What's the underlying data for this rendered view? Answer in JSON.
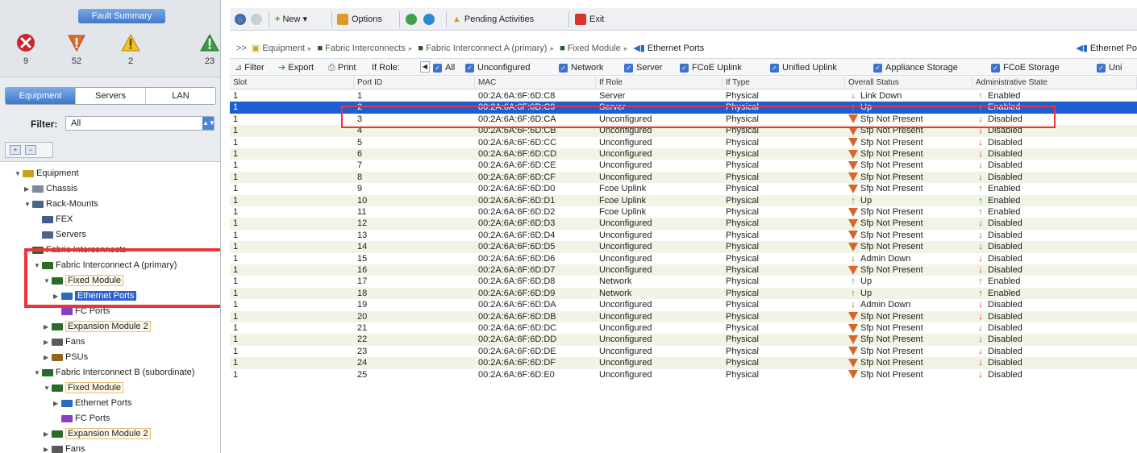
{
  "fault_summary": {
    "title": "Fault Summary",
    "counts": [
      {
        "icon": "critical-x-icon",
        "value": "9"
      },
      {
        "icon": "major-triangle-down-icon",
        "value": "52"
      },
      {
        "icon": "minor-warning-icon",
        "value": "2"
      },
      {
        "icon": "warning-icon",
        "value": "23"
      }
    ]
  },
  "left_tabs": [
    "Equipment",
    "Servers",
    "LAN"
  ],
  "filter": {
    "label": "Filter:",
    "value": "All"
  },
  "tree": [
    {
      "label": "Equipment",
      "indent": 0,
      "twisty": "▼",
      "icon": "equipment-icon"
    },
    {
      "label": "Chassis",
      "indent": 1,
      "twisty": "▶",
      "icon": "chassis-icon"
    },
    {
      "label": "Rack-Mounts",
      "indent": 1,
      "twisty": "▼",
      "icon": "rack-icon"
    },
    {
      "label": "FEX",
      "indent": 2,
      "twisty": "",
      "icon": "fex-icon"
    },
    {
      "label": "Servers",
      "indent": 2,
      "twisty": "",
      "icon": "servers-icon"
    },
    {
      "label": "Fabric Interconnects",
      "indent": 1,
      "twisty": "▼",
      "icon": "fabric-icon"
    },
    {
      "label": "Fabric Interconnect A (primary)",
      "indent": 2,
      "twisty": "▼",
      "icon": "fabric-icon"
    },
    {
      "label": "Fixed Module",
      "indent": 3,
      "twisty": "▼",
      "icon": "module-icon"
    },
    {
      "label": "Ethernet Ports",
      "indent": 4,
      "twisty": "▶",
      "icon": "ethernet-port-icon"
    },
    {
      "label": "FC Ports",
      "indent": 4,
      "twisty": "",
      "icon": "fc-port-icon"
    },
    {
      "label": "Expansion Module 2",
      "indent": 3,
      "twisty": "▶",
      "icon": "module-icon"
    },
    {
      "label": "Fans",
      "indent": 3,
      "twisty": "▶",
      "icon": "fan-icon"
    },
    {
      "label": "PSUs",
      "indent": 3,
      "twisty": "▶",
      "icon": "psu-icon"
    },
    {
      "label": "Fabric Interconnect B (subordinate)",
      "indent": 2,
      "twisty": "▼",
      "icon": "fabric-icon"
    },
    {
      "label": "Fixed Module",
      "indent": 3,
      "twisty": "▼",
      "icon": "module-icon"
    },
    {
      "label": "Ethernet Ports",
      "indent": 4,
      "twisty": "▶",
      "icon": "ethernet-port-icon"
    },
    {
      "label": "FC Ports",
      "indent": 4,
      "twisty": "",
      "icon": "fc-port-icon"
    },
    {
      "label": "Expansion Module 2",
      "indent": 3,
      "twisty": "▶",
      "icon": "module-icon"
    },
    {
      "label": "Fans",
      "indent": 3,
      "twisty": "▶",
      "icon": "fan-icon"
    }
  ],
  "toolbar": {
    "new_label": "New",
    "options_label": "Options",
    "pending_label": "Pending Activities",
    "exit_label": "Exit"
  },
  "breadcrumb": {
    "prefix": ">>",
    "items": [
      "Equipment",
      "Fabric Interconnects",
      "Fabric Interconnect A (primary)",
      "Fixed Module",
      "Ethernet Ports"
    ],
    "right_label": "Ethernet Po"
  },
  "filterbar": {
    "filter_label": "Filter",
    "export_label": "Export",
    "print_label": "Print",
    "role_label": "If Role:",
    "checks": [
      "All",
      "Unconfigured",
      "Network",
      "Server",
      "FCoE Uplink",
      "Unified Uplink",
      "Appliance Storage",
      "FCoE Storage",
      "Uni"
    ]
  },
  "table": {
    "columns": [
      "Slot",
      "Port ID",
      "MAC",
      "If Role",
      "If Type",
      "Overall Status",
      "Administrative State"
    ],
    "rows": [
      {
        "slot": "1",
        "port": "1",
        "mac": "00:2A:6A:6F:6D:C8",
        "role": "Server",
        "type": "Physical",
        "status": "Link Down",
        "status_kind": "down",
        "admin": "Enabled",
        "admin_kind": "up"
      },
      {
        "slot": "1",
        "port": "2",
        "mac": "00:2A:6A:6F:6D:C9",
        "role": "Server",
        "type": "Physical",
        "status": "Up",
        "status_kind": "up",
        "admin": "Enabled",
        "admin_kind": "up"
      },
      {
        "slot": "1",
        "port": "3",
        "mac": "00:2A:6A:6F:6D:CA",
        "role": "Unconfigured",
        "type": "Physical",
        "status": "Sfp Not Present",
        "status_kind": "warn",
        "admin": "Disabled",
        "admin_kind": "down"
      },
      {
        "slot": "1",
        "port": "4",
        "mac": "00:2A:6A:6F:6D:CB",
        "role": "Unconfigured",
        "type": "Physical",
        "status": "Sfp Not Present",
        "status_kind": "warn",
        "admin": "Disabled",
        "admin_kind": "down"
      },
      {
        "slot": "1",
        "port": "5",
        "mac": "00:2A:6A:6F:6D:CC",
        "role": "Unconfigured",
        "type": "Physical",
        "status": "Sfp Not Present",
        "status_kind": "warn",
        "admin": "Disabled",
        "admin_kind": "down"
      },
      {
        "slot": "1",
        "port": "6",
        "mac": "00:2A:6A:6F:6D:CD",
        "role": "Unconfigured",
        "type": "Physical",
        "status": "Sfp Not Present",
        "status_kind": "warn",
        "admin": "Disabled",
        "admin_kind": "down"
      },
      {
        "slot": "1",
        "port": "7",
        "mac": "00:2A:6A:6F:6D:CE",
        "role": "Unconfigured",
        "type": "Physical",
        "status": "Sfp Not Present",
        "status_kind": "warn",
        "admin": "Disabled",
        "admin_kind": "down"
      },
      {
        "slot": "1",
        "port": "8",
        "mac": "00:2A:6A:6F:6D:CF",
        "role": "Unconfigured",
        "type": "Physical",
        "status": "Sfp Not Present",
        "status_kind": "warn",
        "admin": "Disabled",
        "admin_kind": "down"
      },
      {
        "slot": "1",
        "port": "9",
        "mac": "00:2A:6A:6F:6D:D0",
        "role": "Fcoe Uplink",
        "type": "Physical",
        "status": "Sfp Not Present",
        "status_kind": "warn",
        "admin": "Enabled",
        "admin_kind": "up"
      },
      {
        "slot": "1",
        "port": "10",
        "mac": "00:2A:6A:6F:6D:D1",
        "role": "Fcoe Uplink",
        "type": "Physical",
        "status": "Up",
        "status_kind": "up",
        "admin": "Enabled",
        "admin_kind": "up"
      },
      {
        "slot": "1",
        "port": "11",
        "mac": "00:2A:6A:6F:6D:D2",
        "role": "Fcoe Uplink",
        "type": "Physical",
        "status": "Sfp Not Present",
        "status_kind": "warn",
        "admin": "Enabled",
        "admin_kind": "up"
      },
      {
        "slot": "1",
        "port": "12",
        "mac": "00:2A:6A:6F:6D:D3",
        "role": "Unconfigured",
        "type": "Physical",
        "status": "Sfp Not Present",
        "status_kind": "warn",
        "admin": "Disabled",
        "admin_kind": "down"
      },
      {
        "slot": "1",
        "port": "13",
        "mac": "00:2A:6A:6F:6D:D4",
        "role": "Unconfigured",
        "type": "Physical",
        "status": "Sfp Not Present",
        "status_kind": "warn",
        "admin": "Disabled",
        "admin_kind": "down"
      },
      {
        "slot": "1",
        "port": "14",
        "mac": "00:2A:6A:6F:6D:D5",
        "role": "Unconfigured",
        "type": "Physical",
        "status": "Sfp Not Present",
        "status_kind": "warn",
        "admin": "Disabled",
        "admin_kind": "down"
      },
      {
        "slot": "1",
        "port": "15",
        "mac": "00:2A:6A:6F:6D:D6",
        "role": "Unconfigured",
        "type": "Physical",
        "status": "Admin Down",
        "status_kind": "down",
        "admin": "Disabled",
        "admin_kind": "down"
      },
      {
        "slot": "1",
        "port": "16",
        "mac": "00:2A:6A:6F:6D:D7",
        "role": "Unconfigured",
        "type": "Physical",
        "status": "Sfp Not Present",
        "status_kind": "warn",
        "admin": "Disabled",
        "admin_kind": "down"
      },
      {
        "slot": "1",
        "port": "17",
        "mac": "00:2A:6A:6F:6D:D8",
        "role": "Network",
        "type": "Physical",
        "status": "Up",
        "status_kind": "up",
        "admin": "Enabled",
        "admin_kind": "up"
      },
      {
        "slot": "1",
        "port": "18",
        "mac": "00:2A:6A:6F:6D:D9",
        "role": "Network",
        "type": "Physical",
        "status": "Up",
        "status_kind": "up",
        "admin": "Enabled",
        "admin_kind": "up"
      },
      {
        "slot": "1",
        "port": "19",
        "mac": "00:2A:6A:6F:6D:DA",
        "role": "Unconfigured",
        "type": "Physical",
        "status": "Admin Down",
        "status_kind": "down",
        "admin": "Disabled",
        "admin_kind": "down"
      },
      {
        "slot": "1",
        "port": "20",
        "mac": "00:2A:6A:6F:6D:DB",
        "role": "Unconfigured",
        "type": "Physical",
        "status": "Sfp Not Present",
        "status_kind": "warn",
        "admin": "Disabled",
        "admin_kind": "down"
      },
      {
        "slot": "1",
        "port": "21",
        "mac": "00:2A:6A:6F:6D:DC",
        "role": "Unconfigured",
        "type": "Physical",
        "status": "Sfp Not Present",
        "status_kind": "warn",
        "admin": "Disabled",
        "admin_kind": "down"
      },
      {
        "slot": "1",
        "port": "22",
        "mac": "00:2A:6A:6F:6D:DD",
        "role": "Unconfigured",
        "type": "Physical",
        "status": "Sfp Not Present",
        "status_kind": "warn",
        "admin": "Disabled",
        "admin_kind": "down"
      },
      {
        "slot": "1",
        "port": "23",
        "mac": "00:2A:6A:6F:6D:DE",
        "role": "Unconfigured",
        "type": "Physical",
        "status": "Sfp Not Present",
        "status_kind": "warn",
        "admin": "Disabled",
        "admin_kind": "down"
      },
      {
        "slot": "1",
        "port": "24",
        "mac": "00:2A:6A:6F:6D:DF",
        "role": "Unconfigured",
        "type": "Physical",
        "status": "Sfp Not Present",
        "status_kind": "warn",
        "admin": "Disabled",
        "admin_kind": "down"
      },
      {
        "slot": "1",
        "port": "25",
        "mac": "00:2A:6A:6F:6D:E0",
        "role": "Unconfigured",
        "type": "Physical",
        "status": "Sfp Not Present",
        "status_kind": "warn",
        "admin": "Disabled",
        "admin_kind": "down"
      }
    ]
  },
  "colors": {
    "selection": "#1d5fd3",
    "highlight_red": "#e8353a",
    "row_alt": "#f0f4e4"
  }
}
